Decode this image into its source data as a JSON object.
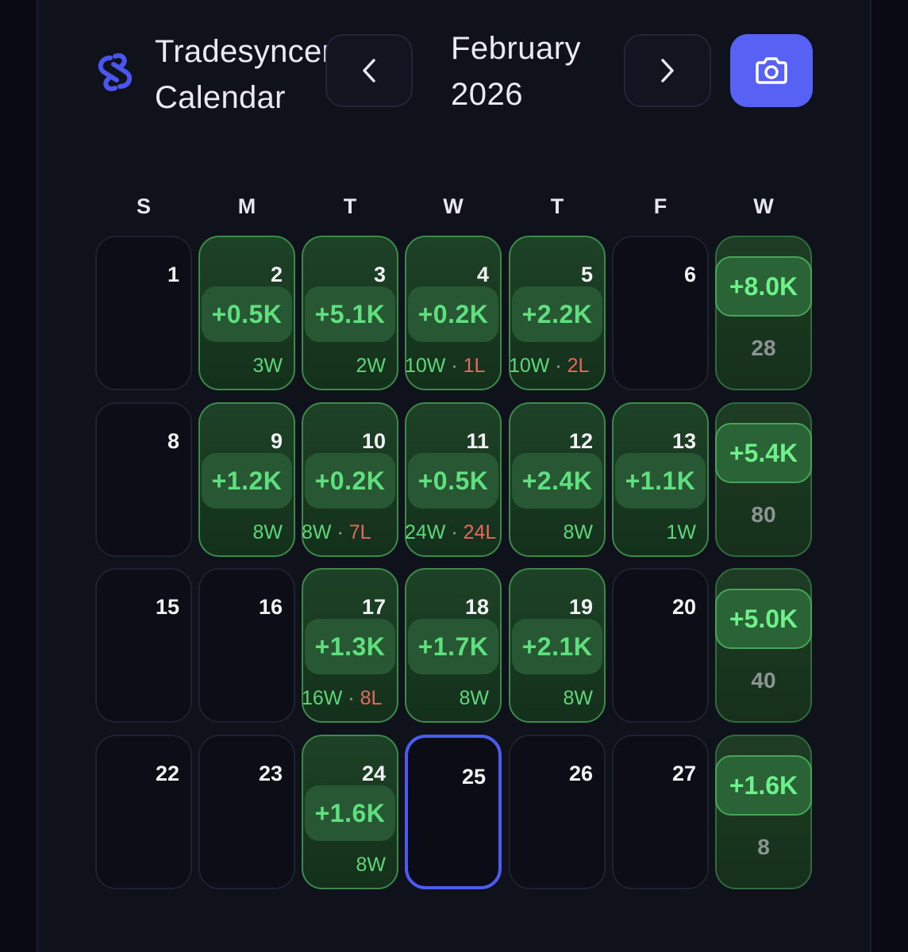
{
  "header": {
    "brand_line1": "Tradesyncer",
    "brand_line2": "Calendar",
    "month_line1": "February",
    "month_line2": "2026",
    "prev_icon": "chevron-left-icon",
    "next_icon": "chevron-right-icon",
    "camera_icon": "camera-icon"
  },
  "weekdays": [
    "S",
    "M",
    "T",
    "W",
    "T",
    "F",
    "W"
  ],
  "weeks": [
    {
      "days": [
        {
          "day": "1"
        },
        {
          "day": "2",
          "pnl": "+0.5K",
          "wins": "3W"
        },
        {
          "day": "3",
          "pnl": "+5.1K",
          "wins": "2W"
        },
        {
          "day": "4",
          "pnl": "+0.2K",
          "wins": "10W",
          "sep": " · ",
          "losses": "1L"
        },
        {
          "day": "5",
          "pnl": "+2.2K",
          "wins": "10W",
          "sep": " · ",
          "losses": "2L"
        },
        {
          "day": "6"
        }
      ],
      "total": {
        "pnl": "+8.0K",
        "count": "28"
      }
    },
    {
      "days": [
        {
          "day": "8"
        },
        {
          "day": "9",
          "pnl": "+1.2K",
          "wins": "8W"
        },
        {
          "day": "10",
          "pnl": "+0.2K",
          "wins": "8W",
          "sep": " · ",
          "losses": "7L"
        },
        {
          "day": "11",
          "pnl": "+0.5K",
          "wins": "24W",
          "sep": " · ",
          "losses": "24L"
        },
        {
          "day": "12",
          "pnl": "+2.4K",
          "wins": "8W"
        },
        {
          "day": "13",
          "pnl": "+1.1K",
          "wins": "1W"
        }
      ],
      "total": {
        "pnl": "+5.4K",
        "count": "80"
      }
    },
    {
      "days": [
        {
          "day": "15"
        },
        {
          "day": "16"
        },
        {
          "day": "17",
          "pnl": "+1.3K",
          "wins": "16W",
          "sep": " · ",
          "losses": "8L"
        },
        {
          "day": "18",
          "pnl": "+1.7K",
          "wins": "8W"
        },
        {
          "day": "19",
          "pnl": "+2.1K",
          "wins": "8W"
        },
        {
          "day": "20"
        }
      ],
      "total": {
        "pnl": "+5.0K",
        "count": "40"
      }
    },
    {
      "days": [
        {
          "day": "22"
        },
        {
          "day": "23"
        },
        {
          "day": "24",
          "pnl": "+1.6K",
          "wins": "8W"
        },
        {
          "day": "25",
          "today": true
        },
        {
          "day": "26"
        },
        {
          "day": "27"
        }
      ],
      "total": {
        "pnl": "+1.6K",
        "count": "8"
      }
    }
  ],
  "colors": {
    "accent": "#5762f5",
    "profit": "#5fe07e",
    "loss": "#e8675e",
    "background": "#0f111b"
  }
}
